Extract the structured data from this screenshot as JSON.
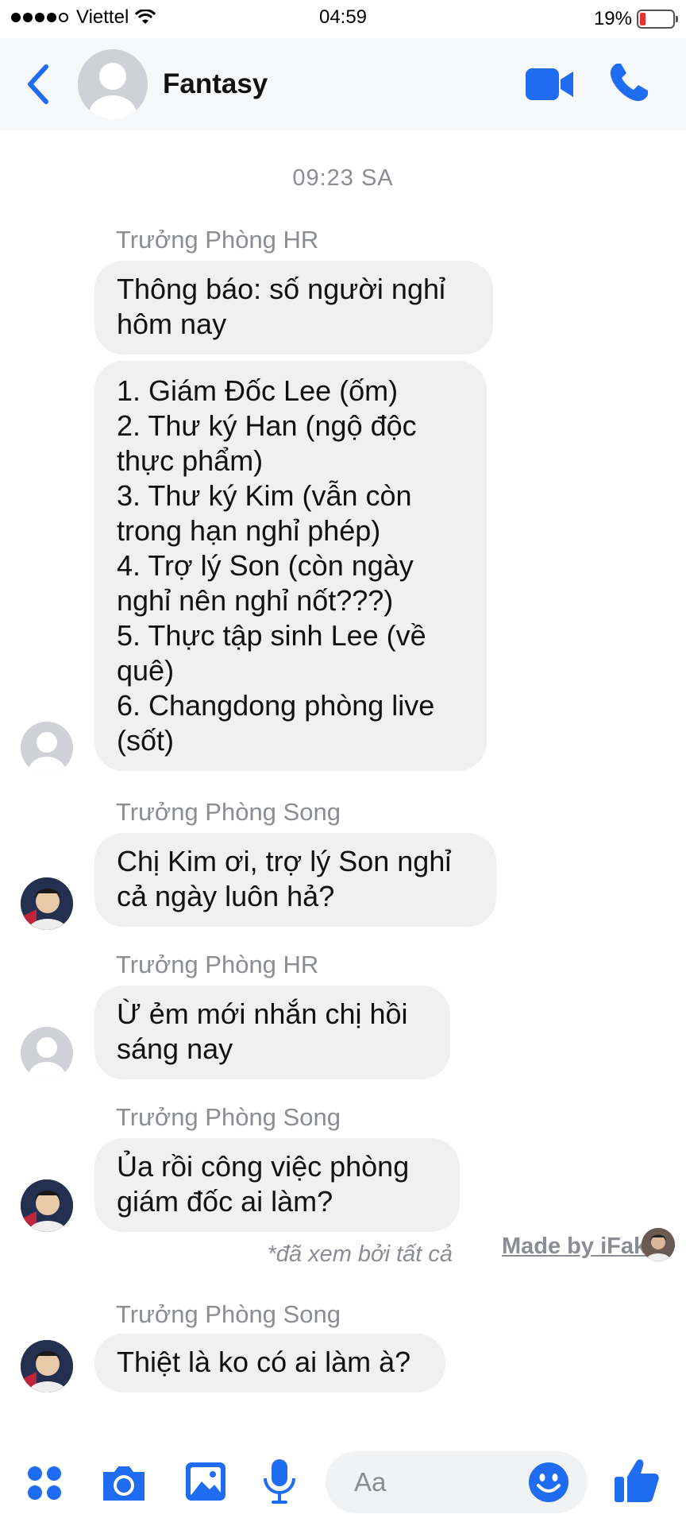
{
  "status_bar": {
    "carrier": "Viettel",
    "time": "04:59",
    "battery": "19%"
  },
  "header": {
    "title": "Fantasy"
  },
  "chat": {
    "timestamp": "09:23 SA",
    "messages": [
      {
        "sender": "Trưởng Phòng HR",
        "bubbles": [
          {
            "lines": [
              "Thông báo: số người nghỉ",
              "hôm nay"
            ]
          },
          {
            "lines": [
              "1. Giám Đốc Lee (ốm)",
              "2. Thư ký Han (ngộ độc",
              "thực phẩm)",
              "3. Thư ký Kim (vẫn còn",
              "trong hạn nghỉ phép)",
              "4. Trợ lý Son (còn ngày",
              "nghỉ nên nghỉ nốt???)",
              "5. Thực tập sinh Lee (về",
              "quê)",
              "6. Changdong phòng live",
              "(sốt)"
            ]
          }
        ]
      },
      {
        "sender": "Trưởng Phòng Song",
        "bubbles": [
          {
            "lines": [
              "Chị Kim ơi, trợ lý Son nghỉ",
              "cả ngày luôn hả?"
            ]
          }
        ]
      },
      {
        "sender": "Trưởng Phòng HR",
        "bubbles": [
          {
            "lines": [
              "Ừ ẻm mới nhắn chị hồi",
              "sáng nay"
            ]
          }
        ]
      },
      {
        "sender": "Trưởng Phòng Song",
        "bubbles": [
          {
            "lines": [
              "Ủa rồi công việc phòng",
              "giám đốc ai làm?"
            ]
          }
        ]
      },
      {
        "sender": "Trưởng Phòng Song",
        "bubbles": [
          {
            "lines": [
              "Thiệt là ko có ai làm à?"
            ]
          }
        ]
      }
    ],
    "seen_text": "*đã xem bởi tất cả",
    "watermark": "Made by iFake"
  },
  "composer": {
    "placeholder": "Aa"
  },
  "colors": {
    "accent": "#1f6cf0",
    "bubble_bg": "#f0f0f0",
    "meta_text": "#8a8d93"
  },
  "icons": [
    "back-chevron-icon",
    "video-call-icon",
    "phone-icon",
    "grid-dots-icon",
    "camera-icon",
    "image-icon",
    "microphone-icon",
    "emoji-icon",
    "like-thumb-icon"
  ]
}
